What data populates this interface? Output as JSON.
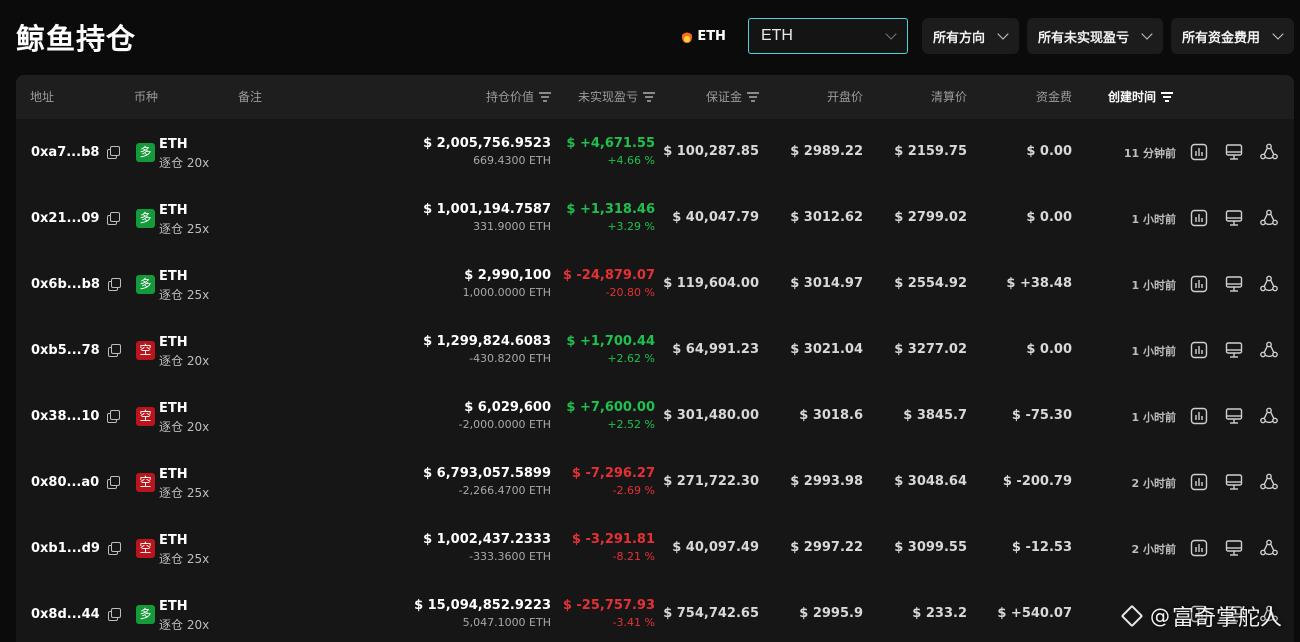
{
  "page": {
    "title": "鲸鱼持仓"
  },
  "filters": {
    "hot_label": "ETH",
    "symbol_value": "ETH",
    "direction": "所有方向",
    "pnl": "所有未实现盈亏",
    "funding": "所有资金费用"
  },
  "table": {
    "headers": {
      "address": "地址",
      "coin": "币种",
      "note": "备注",
      "position_value": "持仓价值",
      "unrealized_pnl": "未实现盈亏",
      "margin": "保证金",
      "entry_price": "开盘价",
      "liq_price": "清算价",
      "funding": "资金费",
      "created": "创建时间"
    },
    "rows": [
      {
        "address": "0xa7...b8",
        "side": "多",
        "side_type": "long",
        "coin": "ETH",
        "mode": "逐仓 20x",
        "value": "$ 2,005,756.9523",
        "qty": "669.4300 ETH",
        "pnl": "$ +4,671.55",
        "pnl_pct": "+4.66 %",
        "pnl_sign": "pos",
        "margin": "$ 100,287.85",
        "entry": "$ 2989.22",
        "liq": "$ 2159.75",
        "funding": "$ 0.00",
        "funding_sign": "zero",
        "time": "11 分钟前"
      },
      {
        "address": "0x21...09",
        "side": "多",
        "side_type": "long",
        "coin": "ETH",
        "mode": "逐仓 25x",
        "value": "$ 1,001,194.7587",
        "qty": "331.9000 ETH",
        "pnl": "$ +1,318.46",
        "pnl_pct": "+3.29 %",
        "pnl_sign": "pos",
        "margin": "$ 40,047.79",
        "entry": "$ 3012.62",
        "liq": "$ 2799.02",
        "funding": "$ 0.00",
        "funding_sign": "zero",
        "time": "1 小时前"
      },
      {
        "address": "0x6b...b8",
        "side": "多",
        "side_type": "long",
        "coin": "ETH",
        "mode": "逐仓 25x",
        "value": "$ 2,990,100",
        "qty": "1,000.0000 ETH",
        "pnl": "$ -24,879.07",
        "pnl_pct": "-20.80 %",
        "pnl_sign": "neg",
        "margin": "$ 119,604.00",
        "entry": "$ 3014.97",
        "liq": "$ 2554.92",
        "funding": "$ +38.48",
        "funding_sign": "pos",
        "time": "1 小时前"
      },
      {
        "address": "0xb5...78",
        "side": "空",
        "side_type": "short",
        "coin": "ETH",
        "mode": "逐仓 20x",
        "value": "$ 1,299,824.6083",
        "qty": "-430.8200 ETH",
        "pnl": "$ +1,700.44",
        "pnl_pct": "+2.62 %",
        "pnl_sign": "pos",
        "margin": "$ 64,991.23",
        "entry": "$ 3021.04",
        "liq": "$ 3277.02",
        "funding": "$ 0.00",
        "funding_sign": "zero",
        "time": "1 小时前"
      },
      {
        "address": "0x38...10",
        "side": "空",
        "side_type": "short",
        "coin": "ETH",
        "mode": "逐仓 20x",
        "value": "$ 6,029,600",
        "qty": "-2,000.0000 ETH",
        "pnl": "$ +7,600.00",
        "pnl_pct": "+2.52 %",
        "pnl_sign": "pos",
        "margin": "$ 301,480.00",
        "entry": "$ 3018.6",
        "liq": "$ 3845.7",
        "funding": "$ -75.30",
        "funding_sign": "neg",
        "time": "1 小时前"
      },
      {
        "address": "0x80...a0",
        "side": "空",
        "side_type": "short",
        "coin": "ETH",
        "mode": "逐仓 25x",
        "value": "$ 6,793,057.5899",
        "qty": "-2,266.4700 ETH",
        "pnl": "$ -7,296.27",
        "pnl_pct": "-2.69 %",
        "pnl_sign": "neg",
        "margin": "$ 271,722.30",
        "entry": "$ 2993.98",
        "liq": "$ 3048.64",
        "funding": "$ -200.79",
        "funding_sign": "neg",
        "time": "2 小时前"
      },
      {
        "address": "0xb1...d9",
        "side": "空",
        "side_type": "short",
        "coin": "ETH",
        "mode": "逐仓 25x",
        "value": "$ 1,002,437.2333",
        "qty": "-333.3600 ETH",
        "pnl": "$ -3,291.81",
        "pnl_pct": "-8.21 %",
        "pnl_sign": "neg",
        "margin": "$ 40,097.49",
        "entry": "$ 2997.22",
        "liq": "$ 3099.55",
        "funding": "$ -12.53",
        "funding_sign": "neg",
        "time": "2 小时前"
      },
      {
        "address": "0x8d...44",
        "side": "多",
        "side_type": "long",
        "coin": "ETH",
        "mode": "逐仓 20x",
        "value": "$ 15,094,852.9223",
        "qty": "5,047.1000 ETH",
        "pnl": "$ -25,757.93",
        "pnl_pct": "-3.41 %",
        "pnl_sign": "neg",
        "margin": "$ 754,742.65",
        "entry": "$ 2995.9",
        "liq": "$ 233.2",
        "funding": "$ +540.07",
        "funding_sign": "pos",
        "time": ""
      }
    ]
  },
  "row_actions": [
    "chart-icon",
    "monitor-icon",
    "network-icon"
  ],
  "watermark": {
    "text": "富奇掌舵人"
  },
  "colors": {
    "positive": "#1fc04e",
    "negative": "#e53035",
    "long_badge": "#149a3a",
    "short_badge": "#b8161c",
    "accent_border": "#4fd1d9"
  }
}
